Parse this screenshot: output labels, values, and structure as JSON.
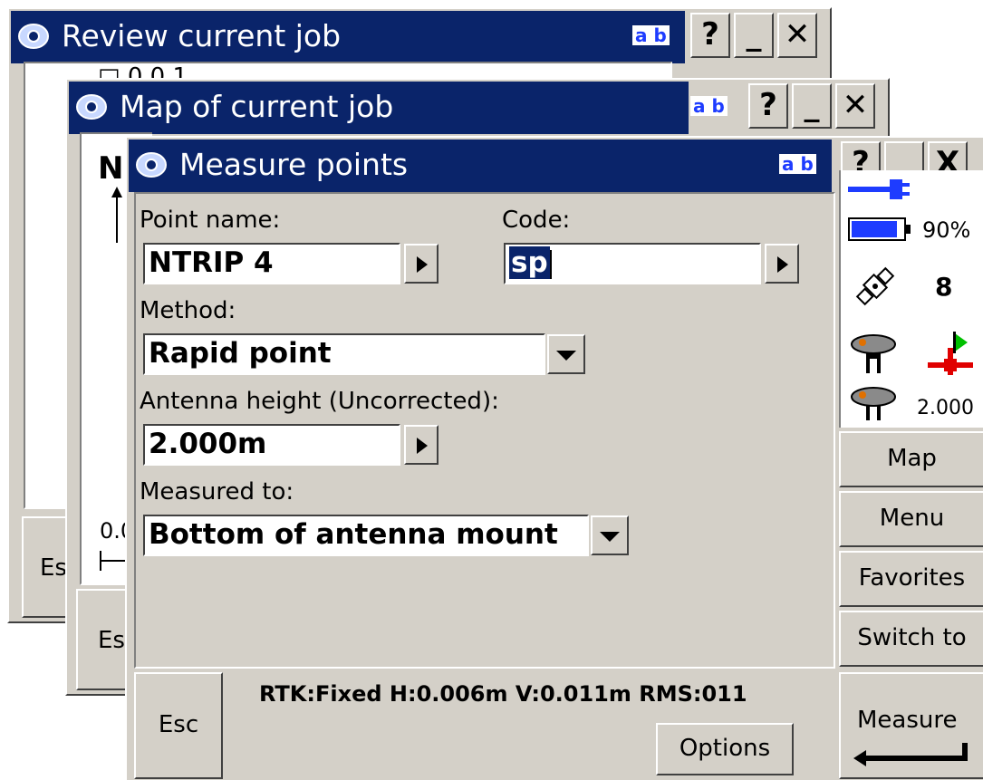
{
  "windows": {
    "back": {
      "title": "Review current job",
      "ab": "a b",
      "partial_item": "□ 0 0 1",
      "esc": "Es"
    },
    "middle": {
      "title": "Map of current job",
      "ab": "a b",
      "north": "N",
      "scale": "0.0",
      "esc": "Es"
    },
    "front": {
      "title": "Measure points",
      "ab": "a b",
      "help": "?",
      "minimize": "_",
      "close": "X"
    }
  },
  "form": {
    "point_name_label": "Point name:",
    "point_name_value": "NTRIP 4",
    "code_label": "Code:",
    "code_value": "sp",
    "method_label": "Method:",
    "method_value": "Rapid point",
    "antenna_height_label": "Antenna height (Uncorrected):",
    "antenna_height_value": "2.000m",
    "measured_to_label": "Measured to:",
    "measured_to_value": "Bottom of antenna mount"
  },
  "status": {
    "battery_percent": "90%",
    "satellites": "8",
    "antenna_height": "2.000",
    "battery_level": 0.9
  },
  "side_buttons": {
    "map": "Map",
    "menu": "Menu",
    "favorites": "Favorites",
    "switch_to": "Switch to"
  },
  "bottom": {
    "esc": "Esc",
    "rtk_status": "RTK:Fixed H:0.006m V:0.011m RMS:011",
    "options": "Options",
    "measure": "Measure"
  }
}
